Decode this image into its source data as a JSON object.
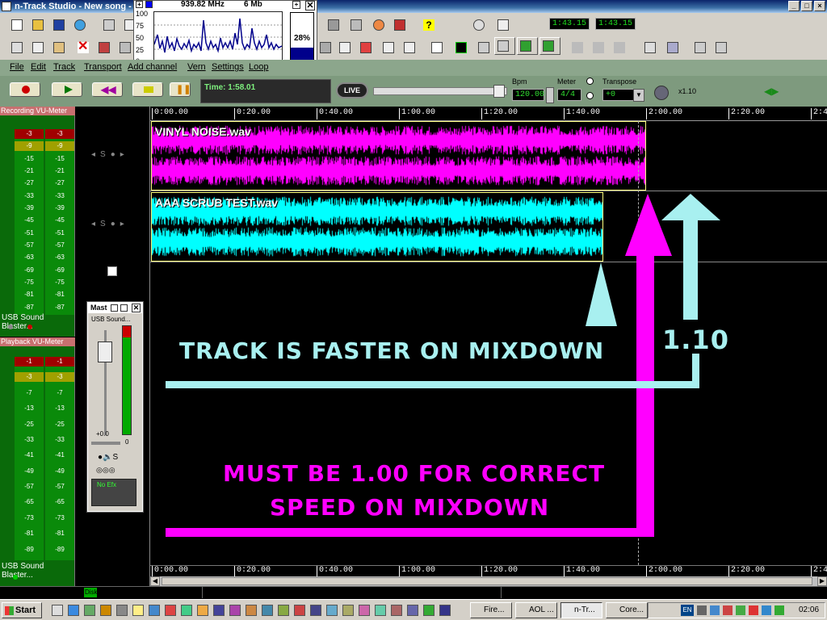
{
  "window": {
    "title": "n-Track Studio - New song - [T"
  },
  "perf": {
    "freq": "939.82 MHz",
    "mem": "6 Mb",
    "y_ticks": [
      "100",
      "75",
      "50",
      "25",
      "0"
    ],
    "cpu_percent": "28%",
    "cpu_level": 0.28
  },
  "toolbar": {
    "time1": "1:43.15",
    "time2": "1:43.15"
  },
  "menu": [
    "File",
    "Edit",
    "Track",
    "Transport",
    "Add channel",
    "Vern",
    "Settings",
    "Loop"
  ],
  "transport": {
    "time_display": "Time: 1:58.01",
    "live_label": "LIVE",
    "bpm_label": "Bpm",
    "bpm_value": "120.00",
    "meter_label": "Meter",
    "meter_value": "4/4",
    "transpose_label": "Transpose",
    "transpose_value": "+0",
    "speed": "x1.10"
  },
  "recording_vu": {
    "title": "Recording VU-Meter",
    "device": "USB Sound Blaster...",
    "levels": [
      "-3",
      "-9",
      "-15",
      "-21",
      "-27",
      "-33",
      "-39",
      "-45",
      "-51",
      "-57",
      "-63",
      "-69",
      "-75",
      "-81",
      "-87"
    ]
  },
  "playback_vu": {
    "title": "Playback VU-Meter",
    "device": "USB Sound Blaster...",
    "levels": [
      "-1",
      "-3",
      "-7",
      "-13",
      "-25",
      "-33",
      "-41",
      "-49",
      "-57",
      "-65",
      "-73",
      "-81",
      "-89"
    ]
  },
  "timeline": {
    "ticks": [
      "0:00.00",
      "0:20.00",
      "0:40.00",
      "1:00.00",
      "1:20.00",
      "1:40.00",
      "2:00.00",
      "2:20.00",
      "2:4"
    ]
  },
  "tracks": [
    {
      "name": "VINYL NOISE.wav",
      "color": "#ff00ff"
    },
    {
      "name": "AAA SCRUB TEST.wav",
      "color": "#00ffff"
    }
  ],
  "mixer": {
    "title": "Mast",
    "device": "USB Sound...",
    "gain": "+0.0",
    "pan": "0",
    "efx": "No Efx"
  },
  "annotations": {
    "faster": "TRACK IS FASTER ON MIXDOWN",
    "ratio": "1.10",
    "correct_line1": "MUST BE 1.00 FOR CORRECT",
    "correct_line2": "SPEED ON MIXDOWN",
    "cyan": "#a8f0f0",
    "magenta": "#ff00ff"
  },
  "status": {
    "disk": "Disk"
  },
  "taskbar": {
    "start": "Start",
    "tasks": [
      "Fire...",
      "AOL ...",
      "n-Tr...",
      "Core..."
    ],
    "lang": "EN",
    "clock": "02:06"
  }
}
